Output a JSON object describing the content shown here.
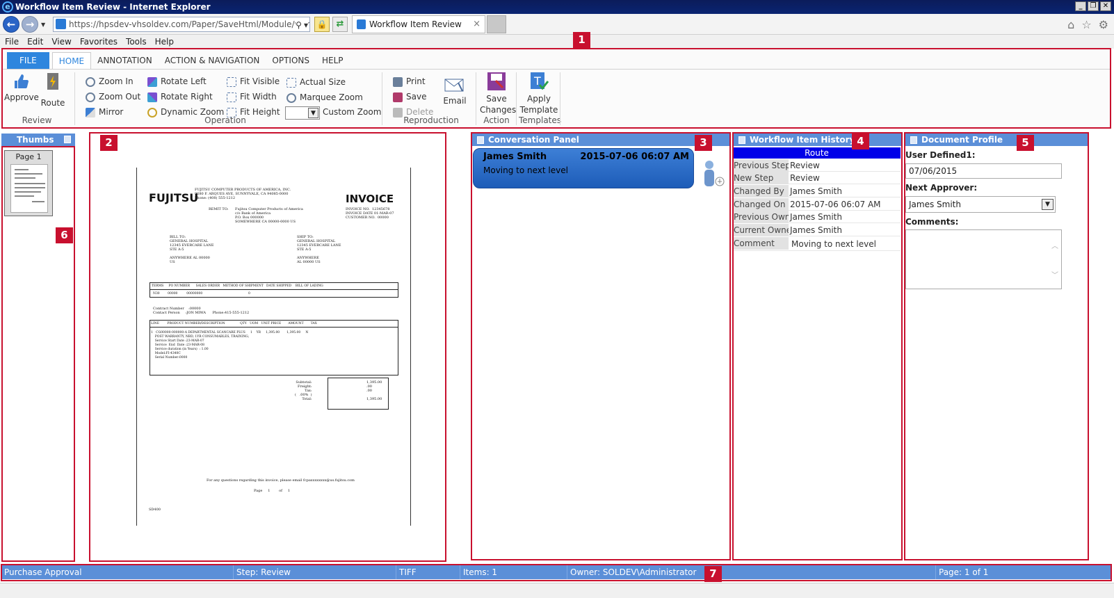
{
  "window": {
    "title": "Workflow Item Review - Internet Explorer"
  },
  "browser": {
    "address": "https://hpsdev-vhsoldev.com/Paper/SaveHtml/Module/work",
    "tab_title": "Workflow Item Review"
  },
  "menubar": [
    "File",
    "Edit",
    "View",
    "Favorites",
    "Tools",
    "Help"
  ],
  "ribbon": {
    "tabs": [
      "FILE",
      "HOME",
      "ANNOTATION",
      "ACTION & NAVIGATION",
      "OPTIONS",
      "HELP"
    ],
    "review": {
      "approve": "Approve",
      "route": "Route",
      "label": "Review"
    },
    "operation": {
      "zoom_in": "Zoom In",
      "zoom_out": "Zoom Out",
      "mirror": "Mirror",
      "rotate_left": "Rotate Left",
      "rotate_right": "Rotate Right",
      "dynamic_zoom": "Dynamic Zoom",
      "fit_visible": "Fit Visible",
      "fit_width": "Fit Width",
      "fit_height": "Fit Height",
      "actual_size": "Actual Size",
      "marquee_zoom": "Marquee Zoom",
      "custom_zoom": "Custom Zoom",
      "label": "Operation"
    },
    "reproduction": {
      "print": "Print",
      "save": "Save",
      "delete": "Delete",
      "email": "Email",
      "label": "Reproduction"
    },
    "action": {
      "save_changes_1": "Save",
      "save_changes_2": "Changes",
      "label": "Action"
    },
    "templates": {
      "apply_1": "Apply",
      "apply_2": "Template",
      "label": "Templates"
    }
  },
  "badges": [
    "1",
    "2",
    "3",
    "4",
    "5",
    "6",
    "7"
  ],
  "thumbs": {
    "title": "Thumbs",
    "page_label": "Page 1"
  },
  "document": {
    "company": "FUJITSU",
    "heading": "INVOICE",
    "address": "FUJITSU COMPUTER PRODUCTS OF AMERICA, INC.\n9680 F. ARQUES AVE, SUNNYVALE, CA 94085-0000\nPhone: (408) 555-1212",
    "remit_label": "REMIT TO:",
    "remit": "Fujitsu Computer Products of America\nc/o Bank of America\nP.O. Box 000000\nSOMEWHERE CA 00000-0000 US",
    "inv_meta": "INVOICE NO.  12345678\nINVOICE DATE 01-MAR-07\nCUSTOMER NO.  00000",
    "bill_to": "BILL TO:\nGENERAL HOSPITAL\n12345 EVERCARE LANE\nSTE A-5\n\nANYWHERE AL 00000\nUS",
    "ship_to": "SHIP TO:\nGENERAL HOSPITAL\n12345 EVERCARE LANE\nSTE A-5\n\nANYWHERE\nAL 00000 US",
    "terms_header": "TERMS     PO NUMBER      SALES ORDER   METHOD OF SHIPMENT   DATE SHIPPED    BILL OF LADING",
    "terms_row": "N30        00000         00000000                                              0",
    "contact": "Contract Number    :00000\nContact Person     :JON MIWA      Phone:415-555-1212",
    "lines_header": "LINE        PRODUCT NUMBER/DESCRIPTION               QTY   UOM   UNIT PRICE       AMOUNT       TAX",
    "lines_body": "1   CG00000-000000-A DEPARTMENTAL SCANCARE PLUS     1    YR     1,395.00       1,395.00     N\n    POST WARRANTY, NBD, 1YR CONSUMABLES, TRAINING,\n    Service Start Date :23-MAR-07\n    Service  End  Date :23-MAR-08\n    Service duration (in Years)  : 1.00\n    Model:FI-4340C\n    Serial Number:0000",
    "totals_labels": "Subtotal:\nFreight:\nTax:\n(   .00%  )\nTotal:",
    "totals_values": "1,395.00\n.00\n.00\n\n1,395.00",
    "footer": "For any questions regarding this invoice, please email fcpaxxxxxxxx@us.fujitsu.com",
    "page": "Page     1        of     1",
    "code": "SD400"
  },
  "conversation": {
    "title": "Conversation Panel",
    "message": {
      "name": "James Smith",
      "date": "2015-07-06 06:07 AM",
      "text": "Moving to next level"
    }
  },
  "history": {
    "title": "Workflow Item History",
    "route": "Route",
    "rows": [
      {
        "key": "Previous Step",
        "value": "Review"
      },
      {
        "key": "New Step",
        "value": "Review"
      },
      {
        "key": "Changed By",
        "value": "James Smith"
      },
      {
        "key": "Changed On",
        "value": "2015-07-06 06:07 AM"
      },
      {
        "key": "Previous Owner",
        "value": "James Smith"
      },
      {
        "key": "Current Owner",
        "value": "James Smith"
      },
      {
        "key": "Comment",
        "value": "Moving to next level"
      }
    ]
  },
  "profile": {
    "title": "Document Profile",
    "user_defined_label": "User Defined1:",
    "user_defined_value": "07/06/2015",
    "next_approver_label": "Next Approver:",
    "next_approver_value": "James Smith",
    "comments_label": "Comments:"
  },
  "status": {
    "workflow": "Purchase Approval",
    "step": "Step: Review",
    "type": "TIFF",
    "items": "Items: 1",
    "owner": "Owner: SOLDEV\\Administrator",
    "page": "Page: 1 of 1"
  },
  "colors": {
    "accent": "#2e86de",
    "highlight": "#c8102e",
    "panel_header": "#5b8fd8"
  }
}
